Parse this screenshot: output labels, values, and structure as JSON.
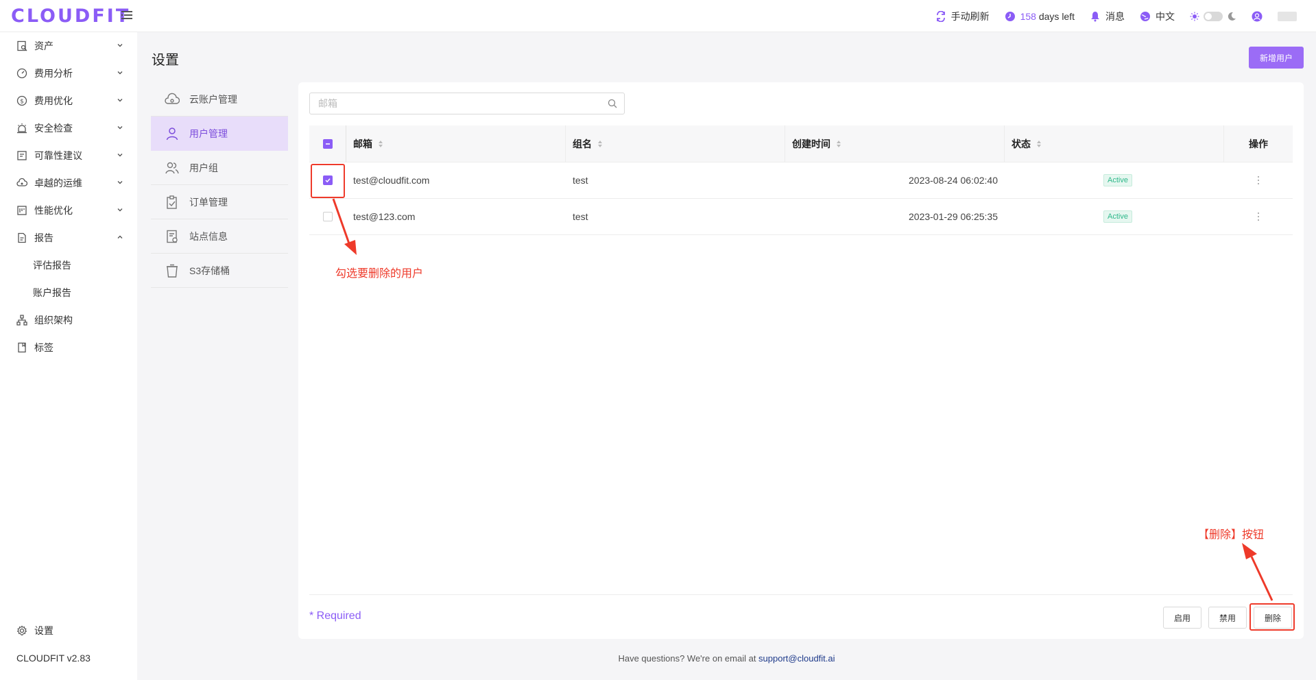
{
  "topbar": {
    "logo": "CLOUDFIT",
    "refresh_label": "手动刷新",
    "days_num": "158",
    "days_suffix": " days left",
    "messages_label": "消息",
    "language_label": "中文"
  },
  "sidebar": {
    "items": [
      {
        "label": "资产",
        "icon": "asset-icon"
      },
      {
        "label": "费用分析",
        "icon": "gauge-icon"
      },
      {
        "label": "费用优化",
        "icon": "dollar-icon"
      },
      {
        "label": "安全检查",
        "icon": "alarm-icon"
      },
      {
        "label": "可靠性建议",
        "icon": "checklist-icon"
      },
      {
        "label": "卓越的运维",
        "icon": "cloud-gear-icon"
      },
      {
        "label": "性能优化",
        "icon": "performance-icon"
      },
      {
        "label": "报告",
        "icon": "report-icon"
      }
    ],
    "sub_items": [
      "评估报告",
      "账户报告"
    ],
    "extra_items": [
      {
        "label": "组织架构",
        "icon": "org-chart-icon"
      },
      {
        "label": "标签",
        "icon": "tag-icon"
      }
    ],
    "settings_label": "设置",
    "version": "CLOUDFIT v2.83"
  },
  "page": {
    "title": "设置",
    "add_user_label": "新增用户"
  },
  "settings_menu": [
    {
      "label": "云账户管理",
      "icon": "cloud-account-icon"
    },
    {
      "label": "用户管理",
      "icon": "user-icon"
    },
    {
      "label": "用户组",
      "icon": "user-group-icon"
    },
    {
      "label": "订单管理",
      "icon": "order-icon"
    },
    {
      "label": "站点信息",
      "icon": "site-info-icon"
    },
    {
      "label": "S3存储桶",
      "icon": "bucket-icon"
    }
  ],
  "search": {
    "placeholder": "邮箱"
  },
  "table": {
    "headers": {
      "email": "邮箱",
      "group": "组名",
      "created": "创建时间",
      "status": "状态",
      "ops": "操作"
    },
    "rows": [
      {
        "email": "test@cloudfit.com",
        "group": "test",
        "created": "2023-08-24 06:02:40",
        "status": "Active",
        "checked": true
      },
      {
        "email": "test@123.com",
        "group": "test",
        "created": "2023-01-29 06:25:35",
        "status": "Active",
        "checked": false
      }
    ]
  },
  "footer_actions": {
    "required": "* Required",
    "enable_label": "启用",
    "disable_label": "禁用",
    "delete_label": "删除"
  },
  "annotations": {
    "check_hint": "勾选要删除的用户",
    "delete_hint": "【删除】按钮"
  },
  "page_footer": {
    "text": "Have questions? We're on email at ",
    "email": "support@cloudfit.ai"
  },
  "colors": {
    "accent": "#8b5cf6",
    "annotation": "#ee3a2a",
    "active_badge": "#2eb88a"
  }
}
